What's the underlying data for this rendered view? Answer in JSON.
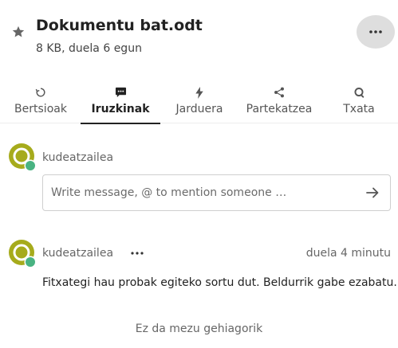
{
  "header": {
    "title": "Dokumentu bat.odt",
    "subtitle": "8 KB, duela 6 egun",
    "favorite_icon": "star-icon",
    "more_icon": "more-horizontal-icon"
  },
  "tabs": [
    {
      "label": "Bertsioak",
      "icon": "history-icon",
      "active": false
    },
    {
      "label": "Iruzkinak",
      "icon": "comment-icon",
      "active": true
    },
    {
      "label": "Jarduera",
      "icon": "lightning-icon",
      "active": false
    },
    {
      "label": "Partekatzea",
      "icon": "share-icon",
      "active": false
    },
    {
      "label": "Txata",
      "icon": "talk-icon",
      "active": false
    }
  ],
  "composer": {
    "author": "kudeatzailea",
    "placeholder": "Write message, @ to mention someone …",
    "send_icon": "arrow-right-icon"
  },
  "comments": [
    {
      "author": "kudeatzailea",
      "time": "duela 4 minutu",
      "message": "Fitxategi hau probak egiteko sortu dut. Beldurrik gabe ezabatu."
    }
  ],
  "footer": {
    "no_more": "Ez da mezu gehiagorik"
  },
  "colors": {
    "avatar_olive": "#a6ab1c",
    "status_online": "#49b382",
    "active_tab_underline": "#222222",
    "more_button_bg": "#dedede"
  }
}
